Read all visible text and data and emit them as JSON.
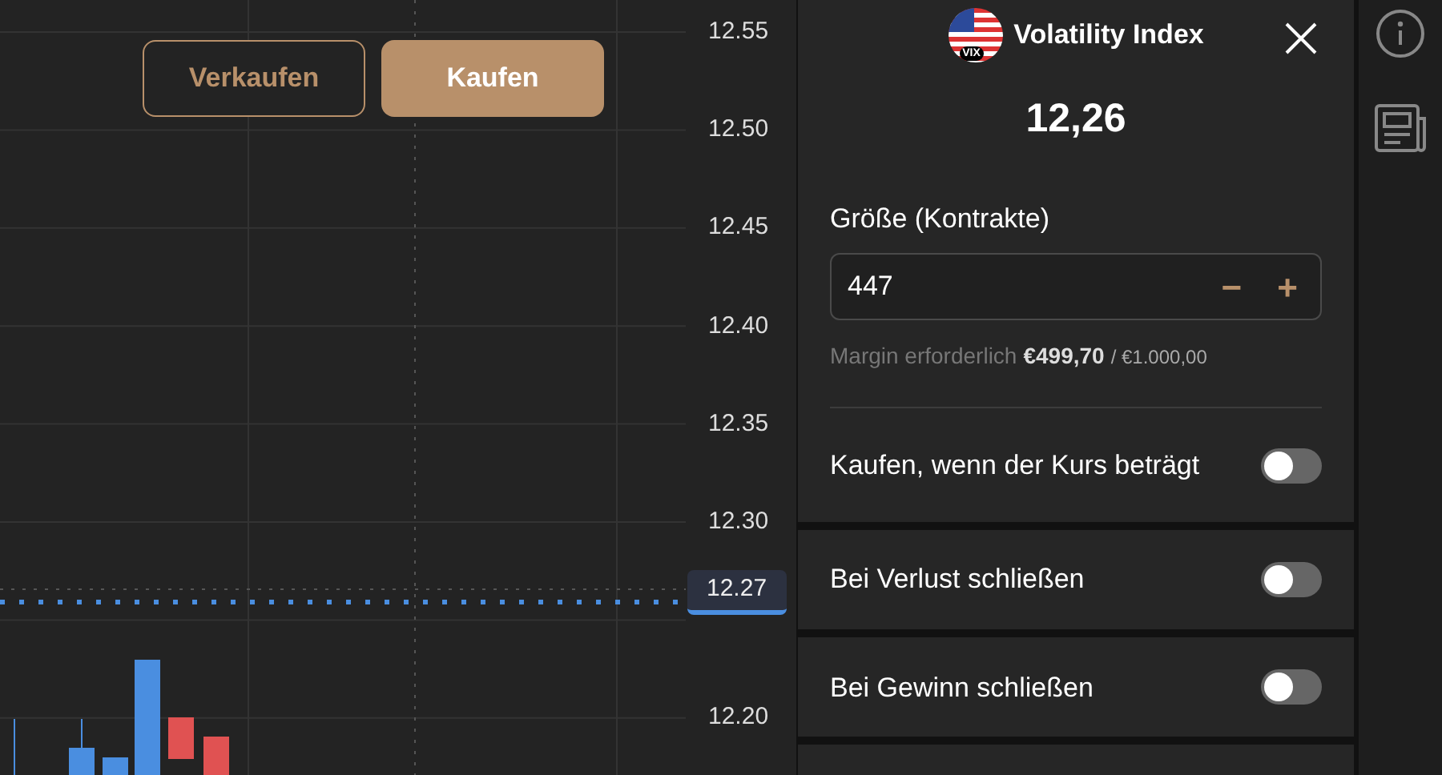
{
  "chart": {
    "buttons": [
      {
        "label": "Verkaufen",
        "kind": "outline"
      },
      {
        "label": "Kaufen",
        "kind": "filled"
      }
    ],
    "price_axis": {
      "upper_labels": [
        "12.55",
        "12.50",
        "12.45",
        "12.40",
        "12.35",
        "12.30"
      ],
      "bottom_label": "12.20"
    },
    "current_price": "12.27"
  },
  "order_panel": {
    "instrument": "Volatility Index",
    "flag_badge": "VIX",
    "price": "12,26",
    "size_label": "Größe (Kontrakte)",
    "size_value": "447",
    "decrement": "−",
    "increment": "+",
    "margin_label": "Margin erforderlich",
    "margin_value": "€499,70",
    "margin_limit": "/ €1.000,00",
    "toggles": [
      {
        "label": "Kaufen, wenn der Kurs beträgt",
        "on": false
      },
      {
        "label": "Bei Verlust schließen",
        "on": false
      },
      {
        "label": "Bei Gewinn schließen",
        "on": false
      }
    ]
  }
}
